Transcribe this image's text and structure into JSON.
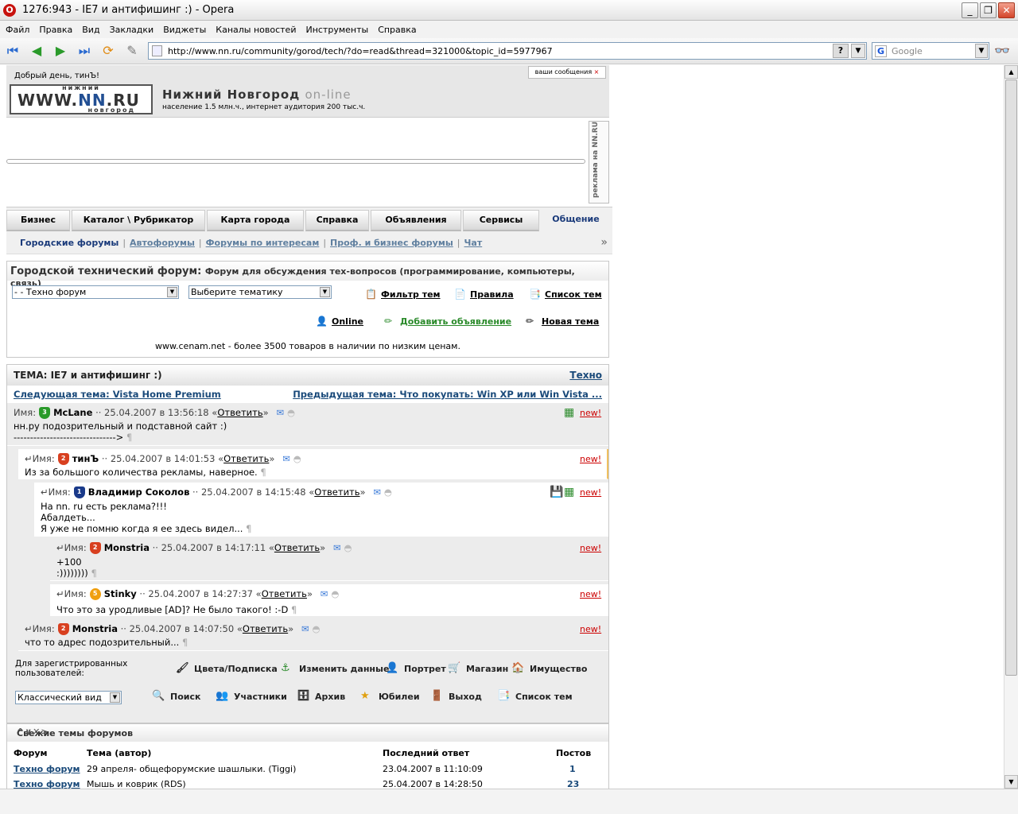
{
  "window": {
    "title": "1276:943 - IE7 и антифишинг :) - Opera",
    "buttons": [
      "_",
      "❐",
      "✕"
    ]
  },
  "menu": [
    "Файл",
    "Правка",
    "Вид",
    "Закладки",
    "Виджеты",
    "Каналы новостей",
    "Инструменты",
    "Справка"
  ],
  "address": {
    "url": "http://www.nn.ru/community/gorod/tech/?do=read&thread=321000&topic_id=5977967",
    "help": "?"
  },
  "search": {
    "placeholder": "Google",
    "engine": "G"
  },
  "site": {
    "greeting": "Добрый день, тинЪ!",
    "logo": {
      "top": "нижний",
      "main_pre": "WWW.",
      "main_brand": "NN",
      "main_post": ".RU",
      "bottom": "новгород"
    },
    "city": "Нижний Новгород",
    "city_suffix": "on-line",
    "population": "население 1.5 млн.ч., интернет аудитория 200 тыс.ч.",
    "messages_btn": "ваши сообщения",
    "ad_tag": "реклама на NN.RU"
  },
  "nav": {
    "tabs": [
      "Бизнес",
      "Каталог \\ Рубрикатор",
      "Карта города",
      "Справка",
      "Объявления",
      "Сервисы",
      "Общение"
    ],
    "active": "Общение",
    "sub": [
      "Городские форумы",
      "Автофорумы",
      "Форумы по интересам",
      "Проф. и бизнес форумы",
      "Чат"
    ]
  },
  "forum": {
    "title": "Городской технический форум:",
    "subtitle": "Форум для обсуждения тех-вопросов (программирование, компьютеры, связь)",
    "select_forum": "- - Техно форум",
    "select_topic": "Выберите тематику",
    "links": {
      "filter": "Фильтр тем",
      "rules": "Правила",
      "topics": "Список тем",
      "online": "Online",
      "add_ad": "Добавить объявление",
      "new_topic": "Новая тема"
    },
    "ad_text": "www.cenam.net - более 3500 товаров в наличии по низким ценам."
  },
  "thread": {
    "title": "ТЕМА: IE7 и антифишинг :)",
    "category": "Техно",
    "next": "Следующая тема: Vista Home Premium",
    "prev": "Предыдущая тема: Что покупать: Win XP или Win Vista ...",
    "name_label": "Имя:",
    "reply": "Ответить",
    "new": "new!",
    "posts": [
      {
        "level": "3",
        "author": "McLane",
        "date": "25.04.2007 в 13:56:18",
        "lines": [
          "нн.ру подозрительный и подставной сайт :)",
          "------------------------------->"
        ]
      },
      {
        "level": "2",
        "author": "тинЪ",
        "date": "25.04.2007 в 14:01:53",
        "lines": [
          "Из за большого количества рекламы, наверное."
        ]
      },
      {
        "level": "1",
        "author": "Владимир Соколов",
        "date": "25.04.2007 в 14:15:48",
        "lines": [
          "На nn. ru есть реклама?!!!",
          "Абалдеть...",
          "Я уже не помню когда я ее здесь видел..."
        ]
      },
      {
        "level": "2",
        "author": "Monstria",
        "date": "25.04.2007 в 14:17:11",
        "lines": [
          "+100",
          ":))))))))"
        ]
      },
      {
        "level": "5",
        "author": "Stinky",
        "date": "25.04.2007 в 14:27:37",
        "lines": [
          "Что это за уродливые [AD]? Не было такого! :-D"
        ]
      },
      {
        "level": "2",
        "author": "Monstria",
        "date": "25.04.2007 в 14:07:50",
        "lines": [
          "что то адрес подозрительный..."
        ]
      }
    ]
  },
  "registered": {
    "label": "Для зарегистрированных пользователей:",
    "view": "Классический вид",
    "links": [
      "Цвета/Подписка",
      "Изменить данные",
      "Портрет",
      "Магазин",
      "Имущество",
      "Поиск",
      "Участники",
      "Архив",
      "Юбилеи",
      "Выход",
      "Список тем"
    ]
  },
  "fresh": {
    "title": "Свежие темы форумов",
    "controls": "^∨✕>",
    "headers": [
      "Форум",
      "Тема (автор)",
      "Последний ответ",
      "Постов"
    ],
    "rows": [
      {
        "forum": "Техно форум",
        "topic": "29 апреля- общефорумские шашлыки.",
        "author": "Tiggi",
        "last": "23.04.2007 в 11:10:09",
        "posts": "1"
      },
      {
        "forum": "Техно форум",
        "topic": "Мышь и коврик",
        "author": "RDS",
        "last": "25.04.2007 в 14:28:50",
        "posts": "23"
      }
    ]
  }
}
